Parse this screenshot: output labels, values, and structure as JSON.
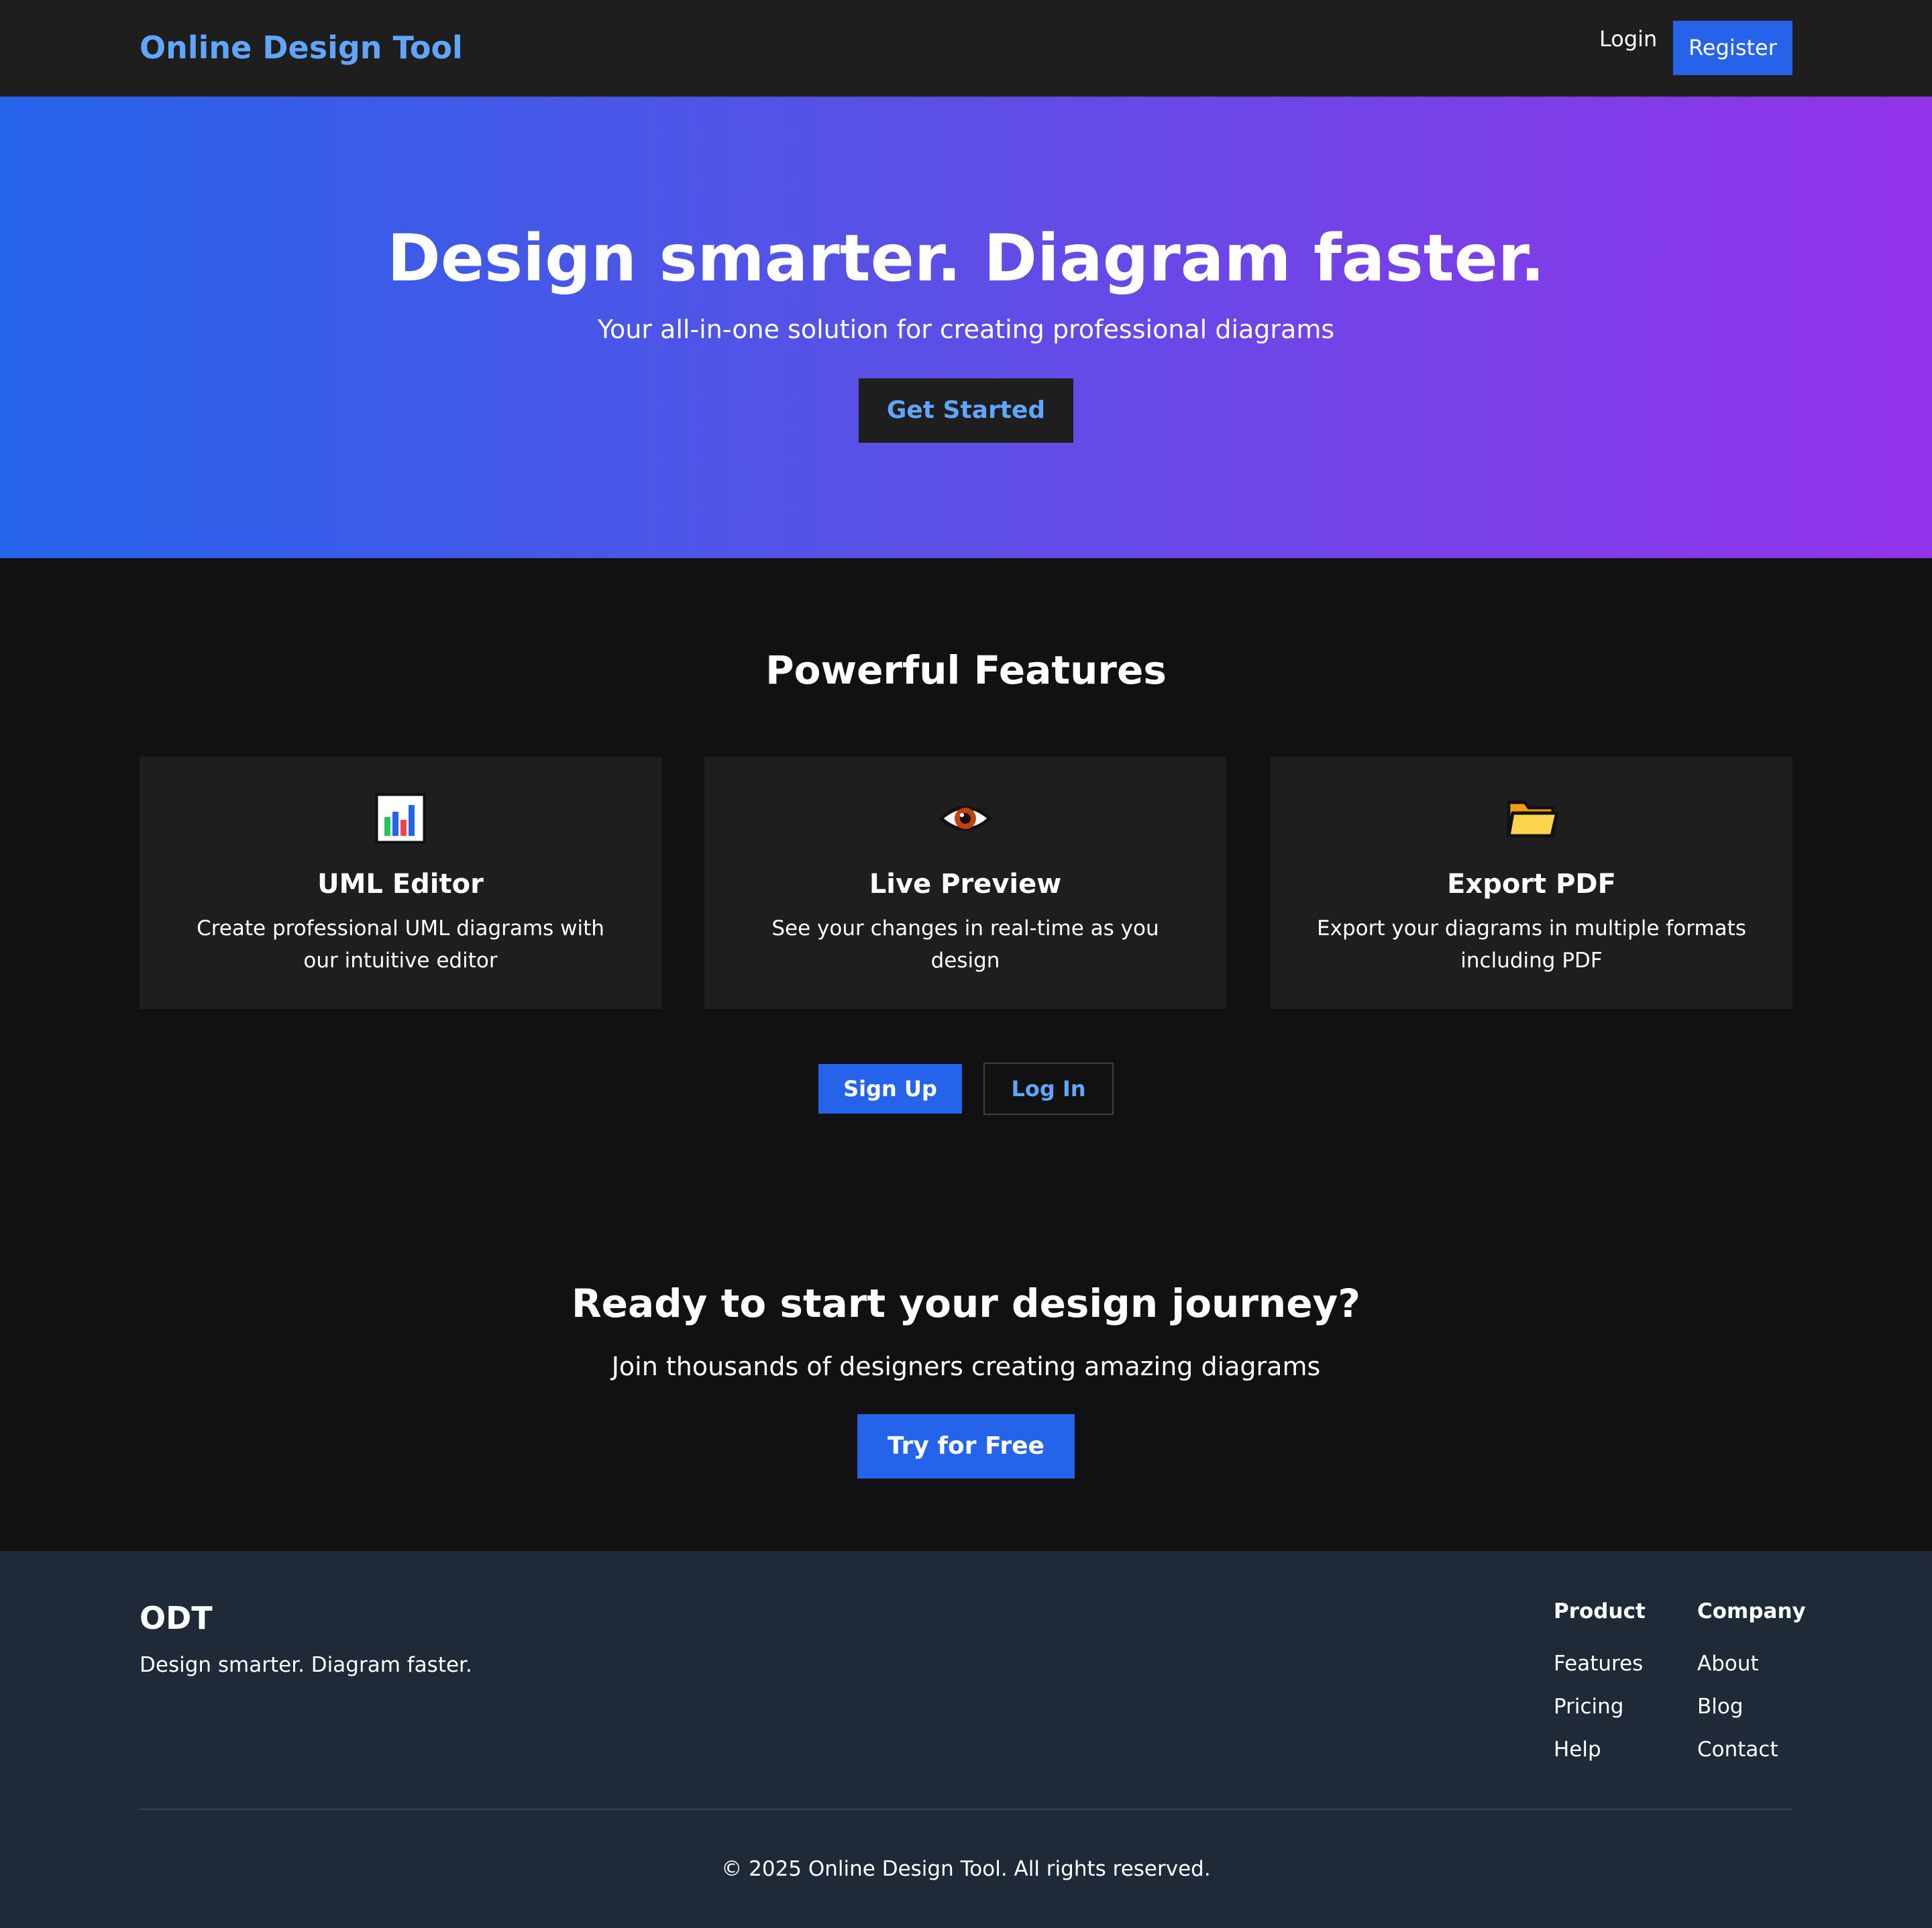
{
  "nav": {
    "brand": "Online Design Tool",
    "login_label": "Login",
    "register_label": "Register"
  },
  "hero": {
    "title": "Design smarter. Diagram faster.",
    "subtitle": "Your all-in-one solution for creating professional diagrams",
    "cta_label": "Get Started"
  },
  "features": {
    "title": "Powerful Features",
    "items": [
      {
        "icon": "bar-chart-icon",
        "title": "UML Editor",
        "description": "Create professional UML diagrams with our intuitive editor"
      },
      {
        "icon": "eye-icon",
        "title": "Live Preview",
        "description": "See your changes in real-time as you design"
      },
      {
        "icon": "folder-icon",
        "title": "Export PDF",
        "description": "Export your diagrams in multiple formats including PDF"
      }
    ],
    "signup_label": "Sign Up",
    "login_label": "Log In"
  },
  "cta": {
    "title": "Ready to start your design journey?",
    "subtitle": "Join thousands of designers creating amazing diagrams",
    "button_label": "Try for Free"
  },
  "footer": {
    "brand": "ODT",
    "tagline": "Design smarter. Diagram faster.",
    "columns": [
      {
        "heading": "Product",
        "links": [
          "Features",
          "Pricing",
          "Help"
        ]
      },
      {
        "heading": "Company",
        "links": [
          "About",
          "Blog",
          "Contact"
        ]
      }
    ],
    "copyright": "© 2025 Online Design Tool. All rights reserved."
  },
  "colors": {
    "accent": "#2563eb",
    "brand_text": "#60a5fa",
    "gradient_start": "#2563eb",
    "gradient_end": "#9333ea",
    "page_bg": "#111111",
    "card_bg": "#1e1e1e",
    "footer_bg": "#1f2937"
  }
}
